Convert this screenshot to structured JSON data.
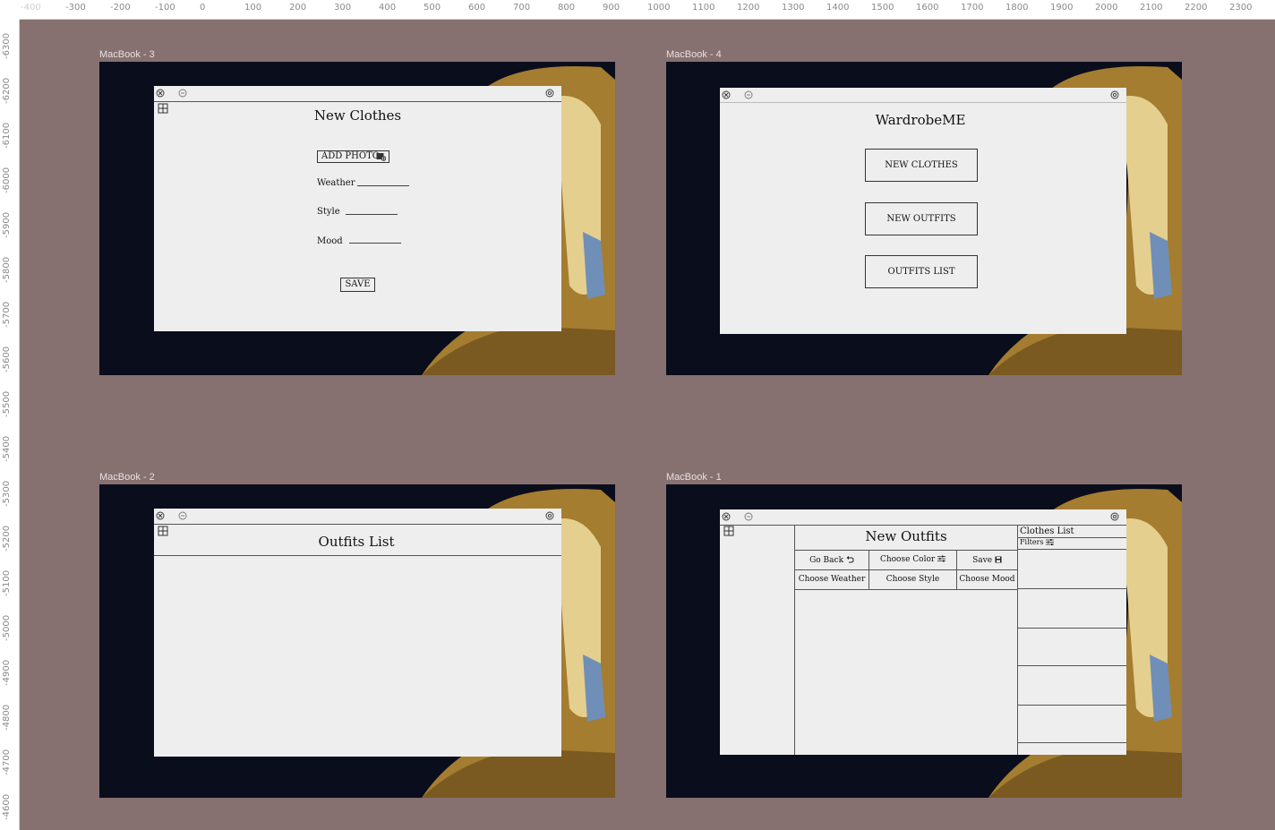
{
  "ruler": {
    "x_labels": [
      "-400",
      "-300",
      "-200",
      "-100",
      "0",
      "100",
      "200",
      "300",
      "400",
      "500",
      "600",
      "700",
      "800",
      "900",
      "1000",
      "1100",
      "1200",
      "1300",
      "1400",
      "1500",
      "1600",
      "1700",
      "1800",
      "1900",
      "2000",
      "2100",
      "2200",
      "2300"
    ],
    "y_labels": [
      "-6300",
      "-6200",
      "-6100",
      "-6000",
      "-5900",
      "-5800",
      "-5700",
      "-5600",
      "-5500",
      "-5400",
      "-5300",
      "-5200",
      "-5100",
      "-5000",
      "-4900",
      "-4800",
      "-4700",
      "-4600"
    ]
  },
  "frames": {
    "f3": {
      "label": "MacBook - 3"
    },
    "f4": {
      "label": "MacBook - 4"
    },
    "f2": {
      "label": "MacBook - 2"
    },
    "f1": {
      "label": "MacBook - 1"
    }
  },
  "new_clothes": {
    "title": "New Clothes",
    "add_photo": "ADD PHOTO",
    "weather": "Weather",
    "style": "Style",
    "mood": "Mood",
    "save": "SAVE"
  },
  "home": {
    "title": "WardrobeME",
    "new_clothes": "NEW CLOTHES",
    "new_outfits": "NEW OUTFITS",
    "outfits_list": "OUTFITS LIST"
  },
  "outfits_list": {
    "title": "Outfits List"
  },
  "new_outfits": {
    "title": "New Outfits",
    "go_back": "Go Back",
    "choose_color": "Choose Color",
    "save": "Save",
    "choose_weather": "Choose Weather",
    "choose_style": "Choose Style",
    "choose_mood": "Choose Mood",
    "clothes_list": "Clothes List",
    "filters": "Filters"
  },
  "colors": {
    "canvas": "#867070",
    "window": "#eeeeee",
    "painting_bg": "#0a0d1c",
    "painting_gold": "#c8a040",
    "painting_blue": "#6f8fb8"
  }
}
